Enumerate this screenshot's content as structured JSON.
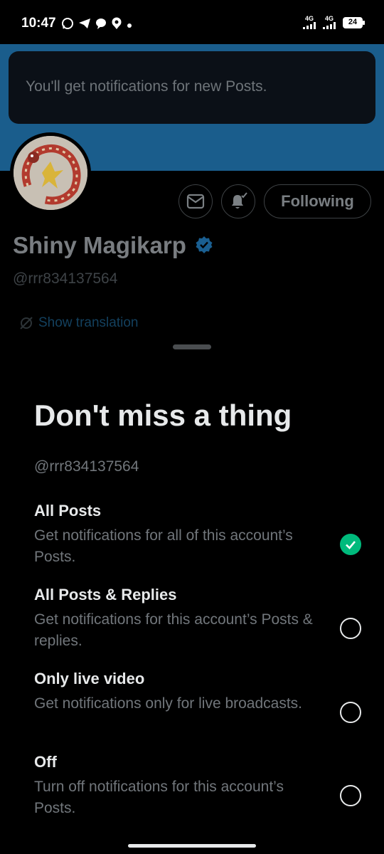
{
  "status_bar": {
    "time": "10:47",
    "network_1": "4G",
    "network_2": "4G",
    "battery": "24"
  },
  "toast": {
    "text": "You'll get notifications for new Posts."
  },
  "profile": {
    "follow_label": "Following",
    "display_name": "Shiny Magikarp",
    "handle": "@rrr834137564",
    "translate_label": "Show translation"
  },
  "sheet": {
    "title": "Don't miss a thing",
    "handle": "@rrr834137564",
    "options": [
      {
        "title": "All Posts",
        "description": "Get notifications for all of this account’s Posts.",
        "selected": true
      },
      {
        "title": "All Posts & Replies",
        "description": "Get notifications for this account’s Posts & replies.",
        "selected": false
      },
      {
        "title": "Only live video",
        "description": "Get notifications only for live broadcasts.",
        "selected": false
      },
      {
        "title": "Off",
        "description": "Turn off notifications for this account’s Posts.",
        "selected": false
      }
    ]
  },
  "colors": {
    "banner": "#1a5d8c",
    "verified": "#1d9bf0",
    "selected": "#00ba7c"
  }
}
